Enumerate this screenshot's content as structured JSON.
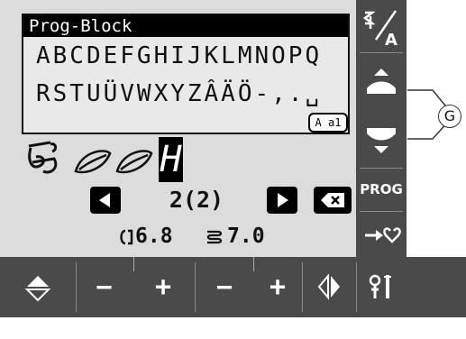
{
  "prog_panel": {
    "title": "Prog-Block",
    "row1": "ABCDEFGHIJKLMNOPQ",
    "row2": "RSTUÜVWXYZÂÄÖ-,.␣",
    "caps_label": "A a1"
  },
  "stitch_row": {
    "cursor_letter": "H"
  },
  "nav": {
    "page_label": "2(2)"
  },
  "params": {
    "width_value": "6.8",
    "length_value": "7.0"
  },
  "side_panel": {
    "prog_label": "PROG"
  },
  "callout": {
    "label": "G"
  }
}
